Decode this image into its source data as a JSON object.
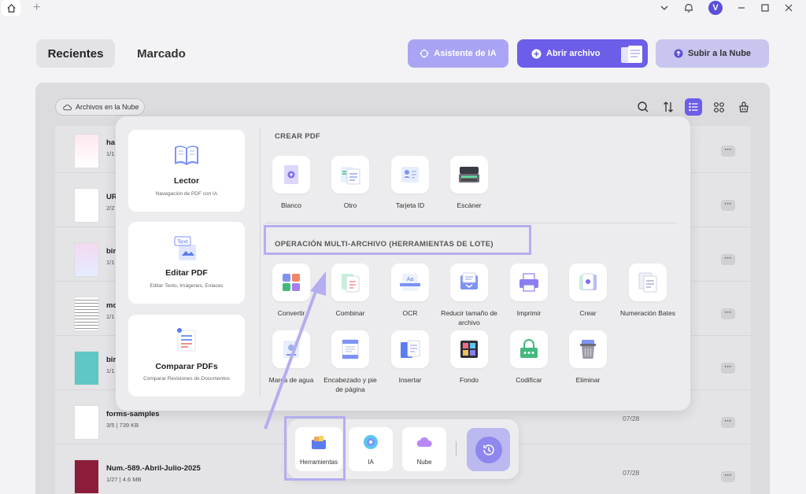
{
  "tabs": {
    "recent": "Recientes",
    "marked": "Marcado"
  },
  "actions": {
    "ai_assistant": "Asistente de IA",
    "open_file": "Abrir archivo",
    "upload_cloud": "Subir a la Nube"
  },
  "cloud_files_chip": "Archivos en la Nube",
  "files": [
    {
      "name": "ha",
      "meta": "1/1",
      "date": ""
    },
    {
      "name": "UR",
      "meta": "2/2",
      "date": ""
    },
    {
      "name": "bir",
      "meta": "1/1",
      "date": ""
    },
    {
      "name": "mo",
      "meta": "1/1",
      "date": ""
    },
    {
      "name": "bir",
      "meta": "1/1",
      "date": ""
    },
    {
      "name": "forms-samples",
      "meta": "3/5 | 739 KB",
      "date": "07/28"
    },
    {
      "name": "Num.-589.-Abril-Julio-2025",
      "meta": "1/27 | 4.6 MB",
      "date": "07/28"
    }
  ],
  "side_cards": {
    "reader": {
      "title": "Lector",
      "sub": "Navegación de PDF con IA"
    },
    "edit": {
      "title": "Editar PDF",
      "sub": "Editar Texto, Imágenes, Enlaces",
      "icon_text": "Text"
    },
    "compare": {
      "title": "Comparar PDFs",
      "sub": "Comparar Revisiones de Documentos"
    }
  },
  "create_pdf": {
    "title": "CREAR PDF",
    "tools": [
      "Blanco",
      "Otro",
      "Tarjeta ID",
      "Escáner"
    ]
  },
  "batch": {
    "title": "OPERACIÓN MULTI-ARCHIVO (HERRAMIENTAS DE LOTE)",
    "row1": [
      "Convertir",
      "Combinar",
      "OCR",
      "Reducir tamaño de archivo",
      "Imprimir",
      "Crear",
      "Numeración Bates"
    ],
    "row2": [
      "Marca de agua",
      "Encabezado y pie de página",
      "Insertar",
      "Fondo",
      "Codificar",
      "Eliminar"
    ]
  },
  "bottom_bar": {
    "tools": "Herramientas",
    "ai": "IA",
    "cloud": "Nube"
  },
  "avatar_letter": "V",
  "colors": {
    "accent": "#6c5ee8",
    "accent_light": "#a9a5f4",
    "highlight": "#b4aef0"
  }
}
